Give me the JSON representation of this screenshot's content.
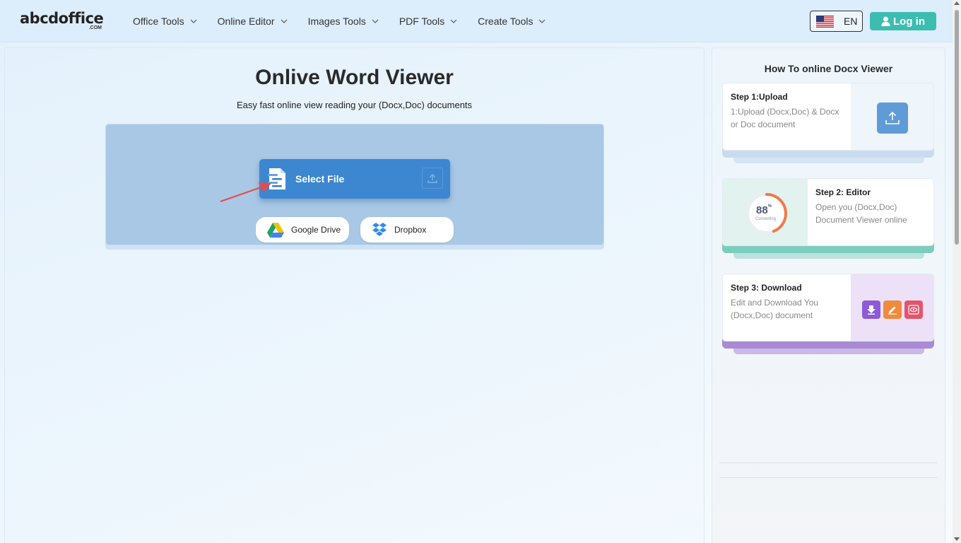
{
  "header": {
    "logo_text": "abcdoffice",
    "logo_sub": ".COM",
    "nav": [
      {
        "label": "Office Tools"
      },
      {
        "label": "Online Editor"
      },
      {
        "label": "Images Tools"
      },
      {
        "label": "PDF Tools"
      },
      {
        "label": "Create Tools"
      }
    ],
    "language": "EN",
    "login_label": "Log in"
  },
  "main": {
    "title": "Onlive Word Viewer",
    "subtitle": "Easy fast online view reading your (Docx,Doc) documents",
    "select_file_label": "Select File",
    "google_drive_label": "Google Drive",
    "dropbox_label": "Dropbox"
  },
  "sidebar": {
    "title": "How To online Docx Viewer",
    "steps": [
      {
        "name": "Step 1:Upload",
        "desc": "1:Upload (Docx,Doc) & Docx or Doc document"
      },
      {
        "name": "Step 2: Editor",
        "desc": "Open you (Docx,Doc) Document Viewer online",
        "progress_value": "88",
        "progress_unit": "%",
        "progress_label": "Converting",
        "progress_fraction": 0.88
      },
      {
        "name": "Step 3: Download",
        "desc": "Edit and Download You (Docx,Doc) document"
      }
    ]
  },
  "colors": {
    "accent_login": "#3dbdb0",
    "select_button": "#3d87d1",
    "upload_area": "#a9c8e6",
    "step2_band": "#7dcdbf",
    "step3_band": "#a98bd4",
    "progress_ring": "#f07a4a"
  }
}
